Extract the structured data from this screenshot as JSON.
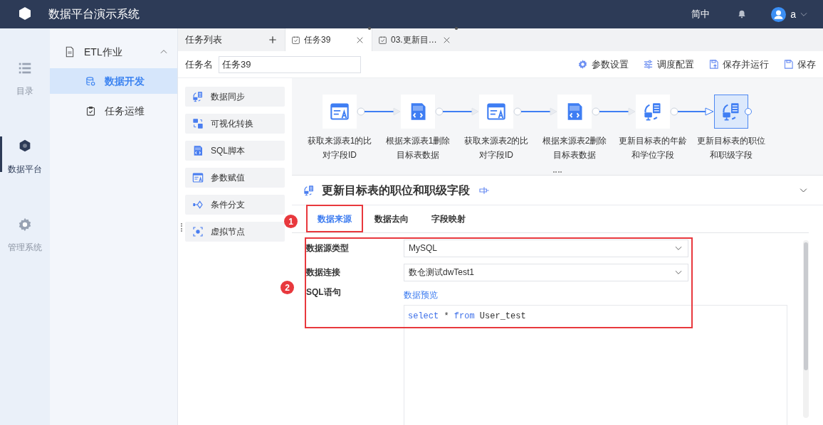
{
  "app": {
    "title": "数据平台演示系统",
    "language": "简中",
    "user": "a"
  },
  "rail": [
    {
      "label": "目录",
      "selected": false
    },
    {
      "label": "数据平台",
      "selected": true
    },
    {
      "label": "管理系统",
      "selected": false
    }
  ],
  "nav": {
    "group": {
      "label": "ETL作业",
      "expanded": true
    },
    "items": [
      {
        "label": "数据开发",
        "selected": true
      },
      {
        "label": "任务运维",
        "selected": false
      }
    ]
  },
  "tabs": [
    {
      "kind": "list",
      "label": "任务列表",
      "selected": false
    },
    {
      "kind": "task",
      "label": "任务39",
      "selected": true,
      "modified": true
    },
    {
      "kind": "task",
      "label": "03.更新目…",
      "selected": false,
      "modified": true
    }
  ],
  "task_name": {
    "label": "任务名",
    "value": "任务39"
  },
  "toolbar": [
    {
      "label": "参数设置"
    },
    {
      "label": "调度配置"
    },
    {
      "label": "保存并运行"
    },
    {
      "label": "保存"
    }
  ],
  "palette": [
    {
      "label": "数据同步",
      "kind": "sync"
    },
    {
      "label": "可视化转换",
      "kind": "visual"
    },
    {
      "label": "SQL脚本",
      "kind": "sql"
    },
    {
      "label": "参数赋值",
      "kind": "assign"
    },
    {
      "label": "条件分支",
      "kind": "branch"
    },
    {
      "label": "虚拟节点",
      "kind": "virtual"
    }
  ],
  "flow": {
    "nodes": [
      {
        "label": "获取来源表1的比对字段ID",
        "kind": "assign",
        "selected": false
      },
      {
        "label": "根据来源表1删除目标表数据",
        "kind": "sql",
        "selected": false
      },
      {
        "label": "获取来源表2的比对字段ID",
        "kind": "assign",
        "selected": false
      },
      {
        "label": "根据来源表2删除目标表数据",
        "kind": "sql",
        "selected": false
      },
      {
        "label": "更新目标表的年龄和学位字段",
        "kind": "sync",
        "selected": false
      },
      {
        "label": "更新目标表的职位和职级字段",
        "kind": "sync",
        "selected": true
      }
    ]
  },
  "detail": {
    "title": "更新目标表的职位和职级字段",
    "tabs": [
      {
        "label": "数据来源",
        "selected": true
      },
      {
        "label": "数据去向",
        "selected": false
      },
      {
        "label": "字段映射",
        "selected": false
      }
    ],
    "fields": [
      {
        "kind": "select",
        "label": "数据源类型",
        "value": "MySQL"
      },
      {
        "kind": "select",
        "label": "数据连接",
        "value": "数仓测试dwTest1"
      },
      {
        "kind": "sql",
        "label": "SQL语句",
        "link": "数据预览",
        "code": [
          {
            "text": "select",
            "kind": "keyword"
          },
          {
            "text": " * ",
            "kind": "plain"
          },
          {
            "text": "from",
            "kind": "keyword"
          },
          {
            "text": " User_test",
            "kind": "plain"
          }
        ]
      }
    ]
  },
  "annotations": [
    {
      "number": "1"
    },
    {
      "number": "2"
    }
  ]
}
